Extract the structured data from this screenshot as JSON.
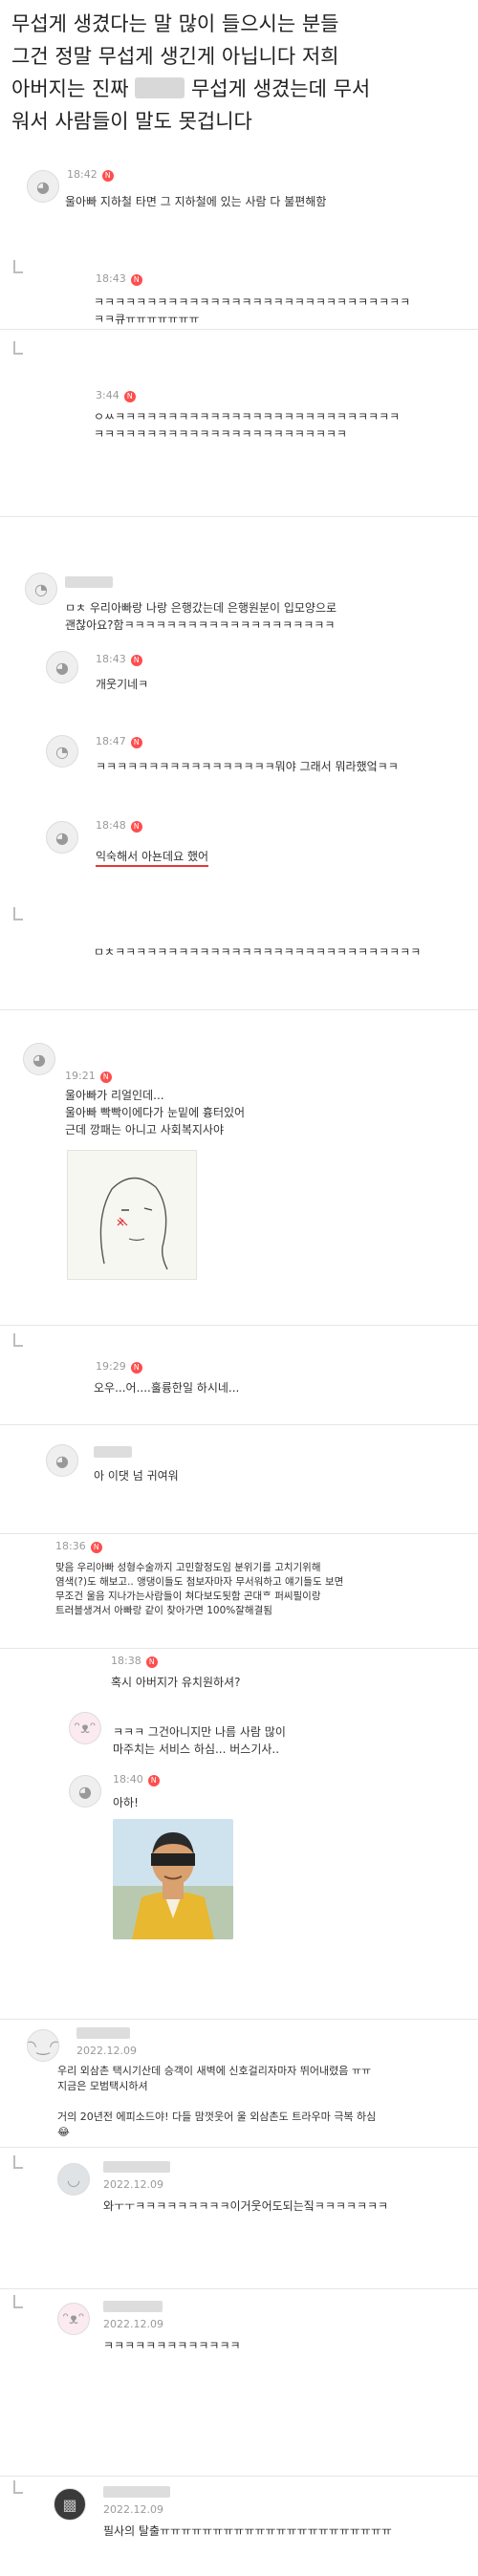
{
  "header": {
    "line1": "무섭게 생겼다는 말 많이 들으시는 분들",
    "line2": "그건 정말 무섭게 생긴게 아닙니다 저희",
    "line3a": "아버지는 진짜",
    "line3b": "무섭게 생겼는데 무서",
    "line4": "워서 사람들이 말도 못겁니다"
  },
  "comments": {
    "c1": {
      "time": "18:42",
      "text": "울아빠 지하철 타면 그 지하철에 있는 사람 다 불편해함"
    },
    "c2": {
      "time": "18:43",
      "text": "ㅋㅋㅋㅋㅋㅋㅋㅋㅋㅋㅋㅋㅋㅋㅋㅋㅋㅋㅋㅋㅋㅋㅋㅋㅋㅋㅋㅋㅋㅋ\nㅋㅋ큐ㅠㅠㅠㅠㅠㅠㅠ"
    },
    "c3": {
      "time": "3:44",
      "text": "ㅇㅆㅋㅋㅋㅋㅋㅋㅋㅋㅋㅋㅋㅋㅋㅋㅋㅋㅋㅋㅋㅋㅋㅋㅋㅋㅋㅋㅋ\nㅋㅋㅋㅋㅋㅋㅋㅋㅋㅋㅋㅋㅋㅋㅋㅋㅋㅋㅋㅋㅋㅋㅋㅋ"
    },
    "c4": {
      "time": "",
      "text": "ㅁㅊ 우리아빠랑 나랑 은행갔는데 은행원분이 입모양으로\n괜찮아요?함ㅋㅋㅋㅋㅋㅋㅋㅋㅋㅋㅋㅋㅋㅋㅋㅋㅋㅋㅋㅋ"
    },
    "c5": {
      "time": "18:43",
      "text": "개웃기네ㅋ"
    },
    "c6": {
      "time": "18:47",
      "text": "ㅋㅋㅋㅋㅋㅋㅋㅋㅋㅋㅋㅋㅋㅋㅋㅋㅋ뭐야 그래서 뭐라했엌ㅋㅋ"
    },
    "c7": {
      "time": "18:48",
      "text": "익숙해서 아뇬데요 했어"
    },
    "c8": {
      "time": "",
      "text": "ㅁㅊㅋㅋㅋㅋㅋㅋㅋㅋㅋㅋㅋㅋㅋㅋㅋㅋㅋㅋㅋㅋㅋㅋㅋㅋㅋㅋㅋㅋㅋ"
    },
    "c9": {
      "time": "19:21",
      "text": "울아빠가 리얼인데...\n울아빠 빡빡이에다가 눈밑에 흉터있어\n근데 깡패는 아니고 사회복지사야"
    },
    "c10": {
      "time": "19:29",
      "text": "오우...어....훌륭한일 하시네..."
    },
    "c11": {
      "time": "",
      "text": "아 이댓 넘 귀여워"
    },
    "c12": {
      "time": "18:36",
      "text": "맞음 우리아빠 성형수술까지 고민할정도임 분위기를 고치기위해\n염색(?)도 해보고.. 앵댕이들도 첨보자마자 무서워하고 얘기들도 보면\n무조건 울음 지나가는사람들이 쳐다보도됫함 곤대ᄒ 퍼씨필이랑\n트러블생겨서 아빠랑 같이 찾아가면 100%잘해결됨"
    },
    "c13": {
      "time": "18:38",
      "text": "혹시 아버지가 유치원하셔?"
    },
    "c14": {
      "time": "",
      "text": "ㅋㅋㅋ 그건아니지만 나름 사람 많이\n마주치는 서비스 하심... 버스기사.."
    },
    "c15": {
      "time": "18:40",
      "text": "아하!"
    },
    "c16": {
      "date": "2022.12.09",
      "text": "우리 외삼촌 택시기산데 승객이 새벽에 신호걸리자마자 뛰어내렸음 ㅠㅠ\n지금은 모범택시하셔\n\n거의 20년전 에피소드야! 다들 맘껏웃어 울 외삼촌도 트라우마 극복 하심\n😂"
    },
    "c17": {
      "date": "2022.12.09",
      "text": "와ㅜㅜㅋㅋㅋㅋㅋㅋㅋㅋㅋ이거웃어도되는짘ㅋㅋㅋㅋㅋㅋㅋ"
    },
    "c18": {
      "date": "2022.12.09",
      "text": "ㅋㅋㅋㅋㅋㅋㅋㅋㅋㅋㅋㅋㅋ"
    },
    "c19": {
      "date": "2022.12.09",
      "text": "필사의 탈출ㅠㅠㅠㅠㅠㅠㅠㅠㅠㅠㅠㅠㅠㅠㅠㅠㅠㅠㅠㅠㅠㅠ"
    }
  },
  "colors": {
    "badge": "#ff4d4d",
    "underline": "#e53935",
    "meta": "#9a9a9a"
  },
  "icons": [
    "reply-arrow-icon",
    "new-badge-icon",
    "avatar-icon"
  ]
}
